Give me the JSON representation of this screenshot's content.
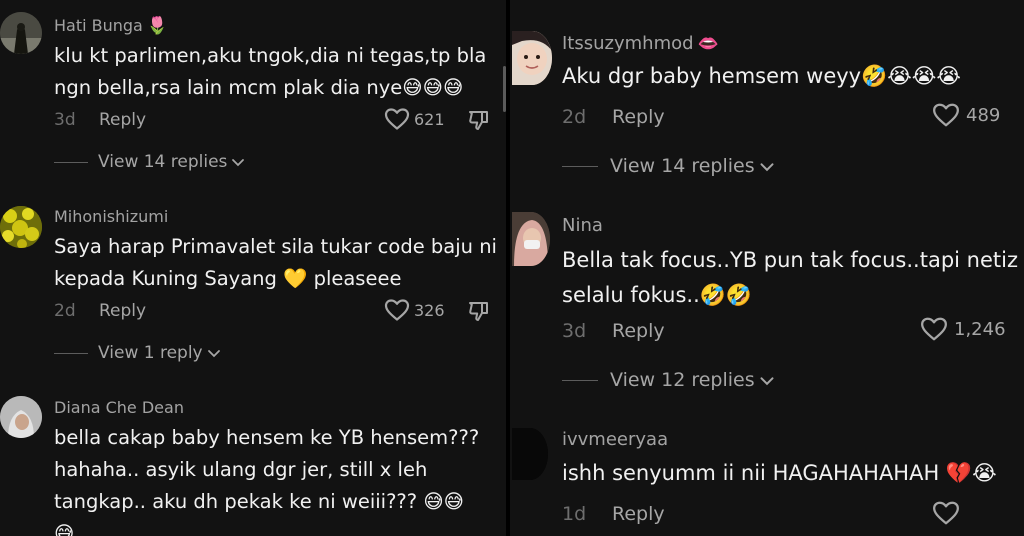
{
  "left": {
    "comments": [
      {
        "username": "Hati Bunga",
        "username_emoji": "🌷",
        "lines": [
          "klu kt parlimen,aku tngok,dia ni tegas,tp bla",
          "ngn bella,rsa lain mcm plak dia nye😅😅😅"
        ],
        "time": "3d",
        "reply_label": "Reply",
        "likes": "621",
        "view_replies": "View 14 replies"
      },
      {
        "username": "Mihonishizumi",
        "lines": [
          "Saya harap Primavalet sila tukar code baju ni",
          "kepada Kuning Sayang 💛 pleaseee"
        ],
        "time": "2d",
        "reply_label": "Reply",
        "likes": "326",
        "view_replies": "View 1 reply"
      },
      {
        "username": "Diana Che Dean",
        "lines": [
          "bella cakap baby hensem ke YB hensem???",
          "hahaha.. asyik ulang dgr jer, still x leh",
          "tangkap.. aku dh pekak ke ni weiii??? 😅😅",
          "😅"
        ]
      }
    ]
  },
  "right": {
    "comments": [
      {
        "username": "Itssuzymhmod",
        "username_emoji": "👄",
        "lines": [
          "Aku dgr baby hemsem weyy🤣😭😭😭"
        ],
        "time": "2d",
        "reply_label": "Reply",
        "likes": "489",
        "view_replies": "View 14 replies"
      },
      {
        "username": "Nina",
        "lines": [
          "Bella tak focus..YB pun tak focus..tapi netiz",
          "selalu fokus..🤣🤣"
        ],
        "time": "3d",
        "reply_label": "Reply",
        "likes": "1,246",
        "view_replies": "View 12 replies"
      },
      {
        "username": "ivvmeeryaa",
        "lines": [
          "ishh senyumm ii nii HAGAHAHAHAH 💔😭"
        ],
        "time": "1d",
        "reply_label": "Reply"
      }
    ]
  }
}
